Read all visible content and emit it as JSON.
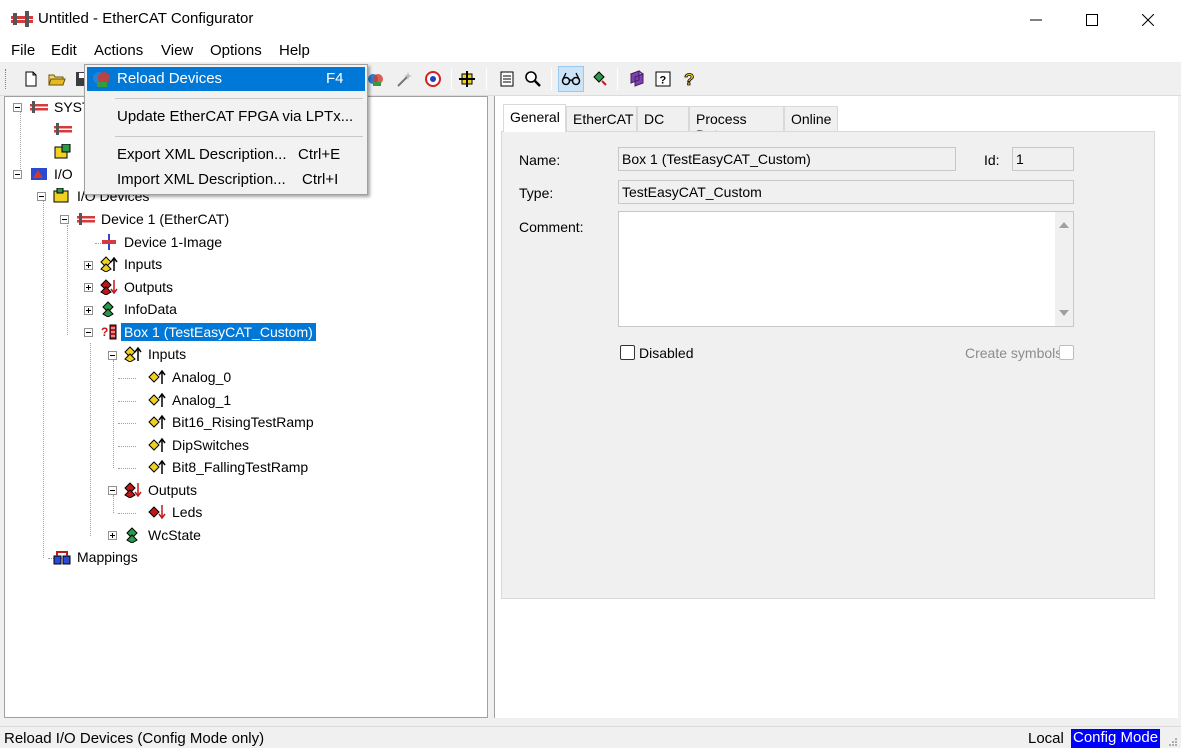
{
  "window": {
    "title": "Untitled - EtherCAT Configurator"
  },
  "menubar": {
    "items": [
      "File",
      "Edit",
      "Actions",
      "View",
      "Options",
      "Help"
    ]
  },
  "actions_menu": {
    "items": [
      {
        "label": "Reload Devices",
        "shortcut": "F4"
      },
      {
        "label": "Update EtherCAT FPGA via LPTx...",
        "shortcut": ""
      },
      {
        "label": "Export XML Description...",
        "shortcut": "Ctrl+E"
      },
      {
        "label": "Import XML Description...",
        "shortcut": "Ctrl+I"
      }
    ]
  },
  "tree": {
    "system": "SYST",
    "io": "I/O",
    "io_devices": "I/O Devices",
    "device1": "Device 1 (EtherCAT)",
    "device1_image": "Device 1-Image",
    "inputs": "Inputs",
    "outputs": "Outputs",
    "infodata": "InfoData",
    "box1": "Box 1 (TestEasyCAT_Custom)",
    "box_inputs": "Inputs",
    "analog0": "Analog_0",
    "analog1": "Analog_1",
    "bit16": "Bit16_RisingTestRamp",
    "dipswitches": "DipSwitches",
    "bit8": "Bit8_FallingTestRamp",
    "box_outputs": "Outputs",
    "leds": "Leds",
    "wcstate": "WcState",
    "mappings": "Mappings"
  },
  "tabs": [
    "General",
    "EtherCAT",
    "DC",
    "Process Data",
    "Online"
  ],
  "general": {
    "name_label": "Name:",
    "name_value": "Box 1 (TestEasyCAT_Custom)",
    "id_label": "Id:",
    "id_value": "1",
    "type_label": "Type:",
    "type_value": "TestEasyCAT_Custom",
    "comment_label": "Comment:",
    "disabled_label": "Disabled",
    "create_symbols_label": "Create symbols"
  },
  "status": {
    "message": "Reload I/O Devices (Config Mode only)",
    "local": "Local",
    "mode": "Config Mode"
  },
  "colors": {
    "selection": "#0078d7",
    "config_mode": "#0000ff"
  }
}
